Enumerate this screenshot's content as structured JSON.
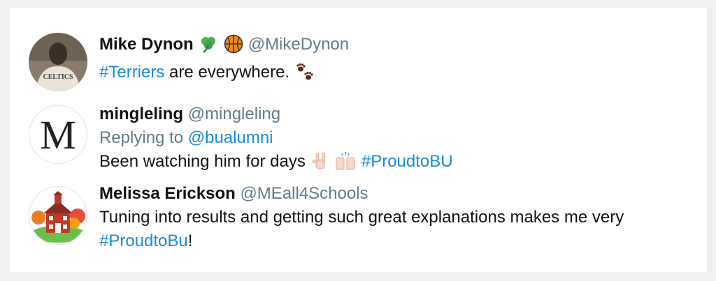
{
  "tweets": [
    {
      "name": "Mike Dynon",
      "handle": "@MikeDynon",
      "body_pre": "",
      "hashtag": "#Terriers",
      "body_post": " are everywhere.",
      "badge_icons": [
        "shamrock-icon",
        "basketball-icon"
      ],
      "trailing_icon": "paw-prints-icon"
    },
    {
      "name": "mingleling",
      "handle": "@mingleling",
      "replying_prefix": "Replying to",
      "replying_to": "@bualumni",
      "body": "Been watching him for days",
      "hashtag": "#ProudtoBU",
      "inline_icons": [
        "rock-on-hand-icon",
        "raising-hands-icon"
      ],
      "avatar_letter": "M"
    },
    {
      "name": "Melissa Erickson",
      "handle": "@MEall4Schools",
      "body": "Tuning into results and getting such great explanations makes me very",
      "hashtag": "#ProudtoBu",
      "suffix": "!"
    }
  ],
  "colors": {
    "link": "#1b8ad8",
    "muted": "#647a88",
    "name": "#111111"
  }
}
